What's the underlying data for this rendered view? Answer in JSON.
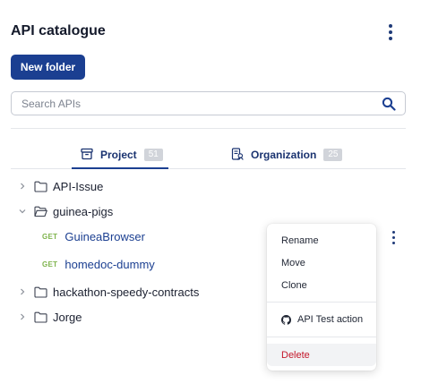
{
  "header": {
    "title": "API catalogue"
  },
  "toolbar": {
    "new_folder_label": "New folder"
  },
  "search": {
    "placeholder": "Search APIs",
    "value": ""
  },
  "tabs": [
    {
      "label": "Project",
      "count": "51",
      "active": true
    },
    {
      "label": "Organization",
      "count": "25",
      "active": false
    }
  ],
  "tree": [
    {
      "type": "folder",
      "label": "API-Issue",
      "expanded": false
    },
    {
      "type": "folder",
      "label": "guinea-pigs",
      "expanded": true
    },
    {
      "type": "request",
      "method": "GET",
      "label": "GuineaBrowser"
    },
    {
      "type": "request",
      "method": "GET",
      "label": "homedoc-dummy"
    },
    {
      "type": "folder",
      "label": "hackathon-speedy-contracts",
      "expanded": false
    },
    {
      "type": "folder",
      "label": "Jorge",
      "expanded": false
    }
  ],
  "context_menu": {
    "items": [
      "Rename",
      "Move",
      "Clone"
    ],
    "action": "API Test action",
    "delete": "Delete"
  },
  "colors": {
    "primary": "#1b3f91",
    "method_get": "#7eb34c",
    "danger": "#c4182b",
    "badge": "#d1d4da"
  },
  "icons": [
    "kebab-menu-icon",
    "search-icon",
    "project-box-icon",
    "organization-icon",
    "chevron-right-icon",
    "chevron-down-icon",
    "folder-icon",
    "folder-open-icon",
    "github-icon"
  ]
}
